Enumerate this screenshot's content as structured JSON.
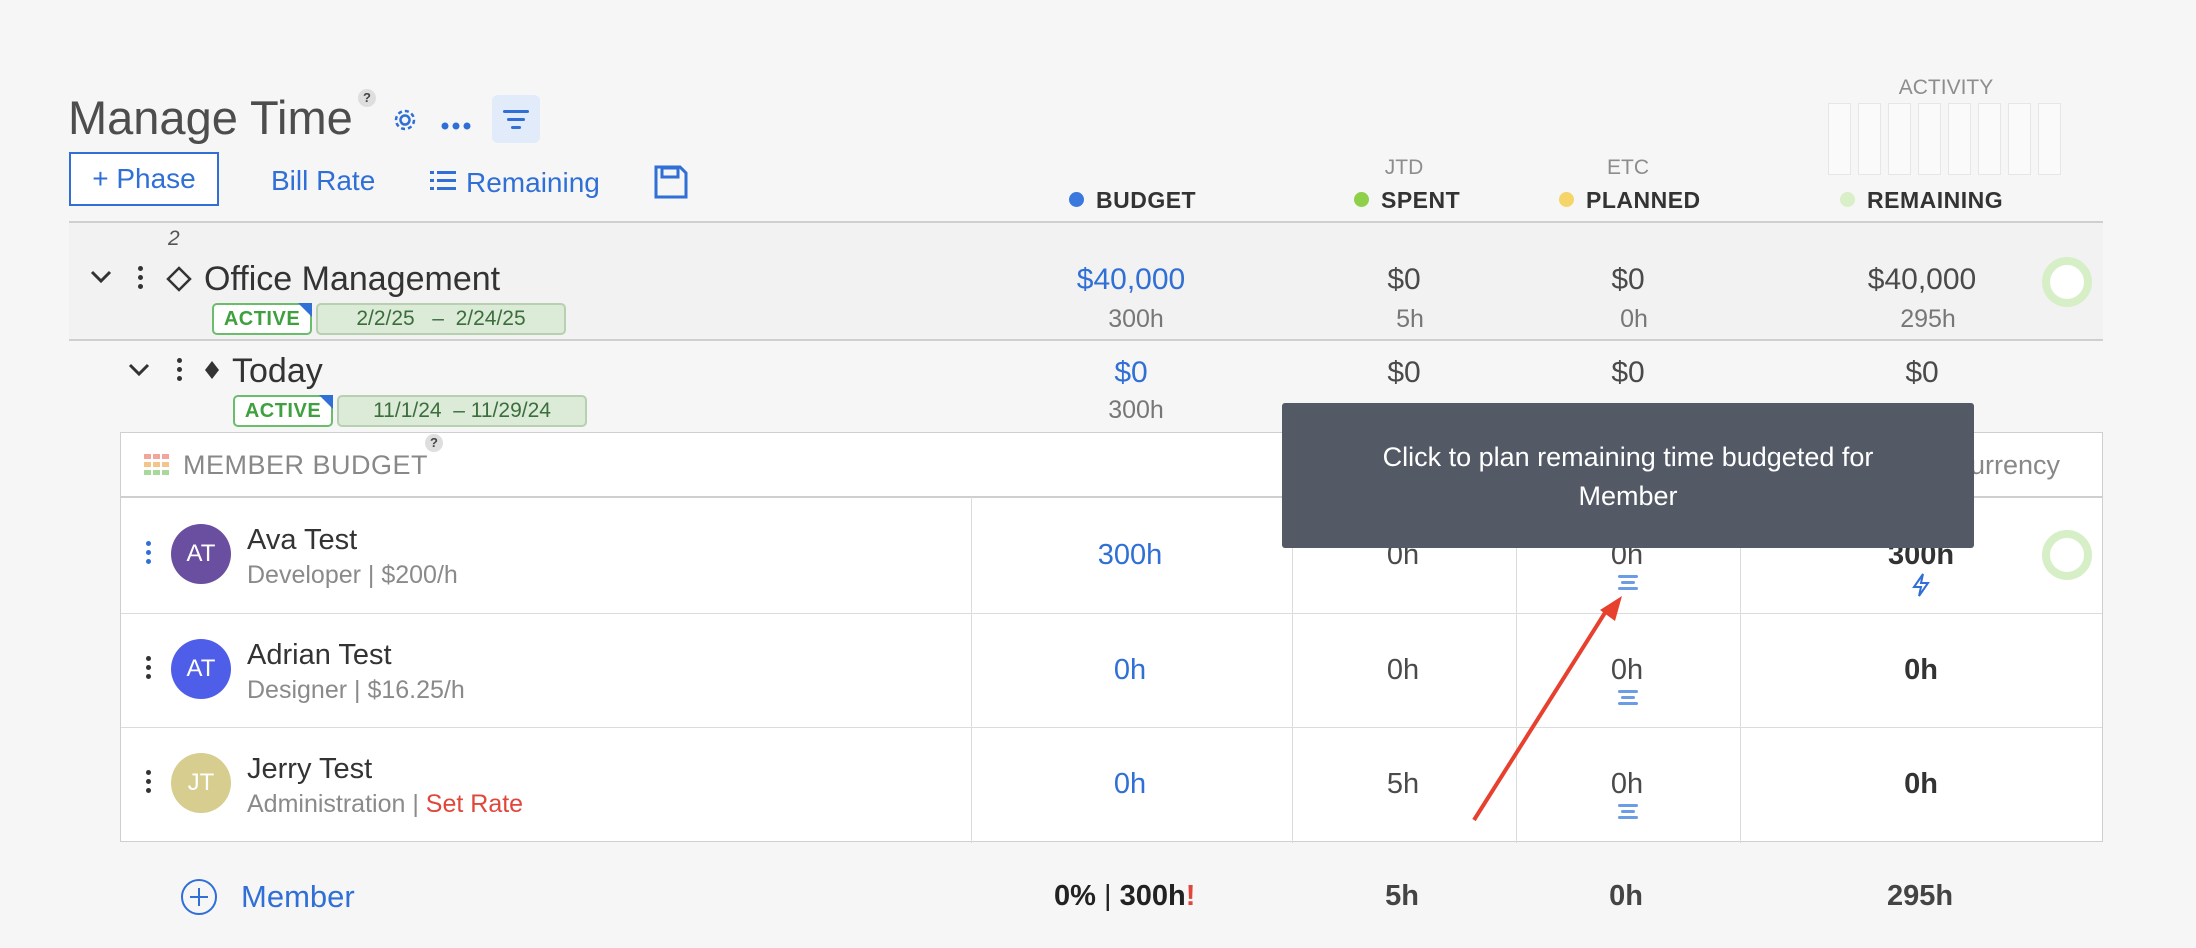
{
  "header": {
    "title": "Manage Time",
    "help": "?",
    "phase_button": "+ Phase",
    "bill_rate": "Bill Rate",
    "remaining": "Remaining",
    "activity_label": "ACTIVITY"
  },
  "columns": {
    "budget": "BUDGET",
    "spent_super": "JTD",
    "spent": "SPENT",
    "planned_super": "ETC",
    "planned": "PLANNED",
    "remaining": "REMAINING"
  },
  "colors": {
    "budget": "#3b78de",
    "spent": "#8fd04a",
    "planned": "#f5d56a",
    "remaining": "#d8efc8"
  },
  "phase": {
    "count": "2",
    "name": "Office Management",
    "status": "ACTIVE",
    "dates": "2/2/25   –  2/24/25",
    "budget": "$40,000",
    "budget_hours": "300h",
    "spent": "$0",
    "spent_hours": "5h",
    "planned": "$0",
    "planned_hours": "0h",
    "remaining": "$40,000",
    "remaining_hours": "295h"
  },
  "subphase": {
    "name": "Today",
    "status": "ACTIVE",
    "dates": "11/1/24  – 11/29/24",
    "budget": "$0",
    "budget_hours": "300h",
    "spent": "$0",
    "planned": "$0",
    "remaining": "$0"
  },
  "member_budget": {
    "title": "MEMBER BUDGET",
    "help": "?",
    "currency_label": "urrency",
    "members": [
      {
        "initials": "AT",
        "color": "#6a4ea0",
        "name": "Ava Test",
        "role": "Developer",
        "rate": "$200/h",
        "budget": "300h",
        "spent": "0h",
        "planned": "0h",
        "remaining": "300h"
      },
      {
        "initials": "AT",
        "color": "#4f5ee8",
        "name": "Adrian Test",
        "role": "Designer",
        "rate": "$16.25/h",
        "budget": "0h",
        "spent": "0h",
        "planned": "0h",
        "remaining": "0h"
      },
      {
        "initials": "JT",
        "color": "#d6cd8e",
        "name": "Jerry Test",
        "role": "Administration",
        "rate": "Set Rate",
        "budget": "0h",
        "spent": "5h",
        "planned": "0h",
        "remaining": "0h"
      }
    ]
  },
  "footer": {
    "add_member": "Member",
    "budget_pct": "0%",
    "budget_sep": "|",
    "budget_hours": "300h",
    "warning": "!",
    "spent": "5h",
    "planned": "0h",
    "remaining": "295h"
  },
  "tooltip": {
    "text": "Click to plan remaining time budgeted for Member"
  }
}
